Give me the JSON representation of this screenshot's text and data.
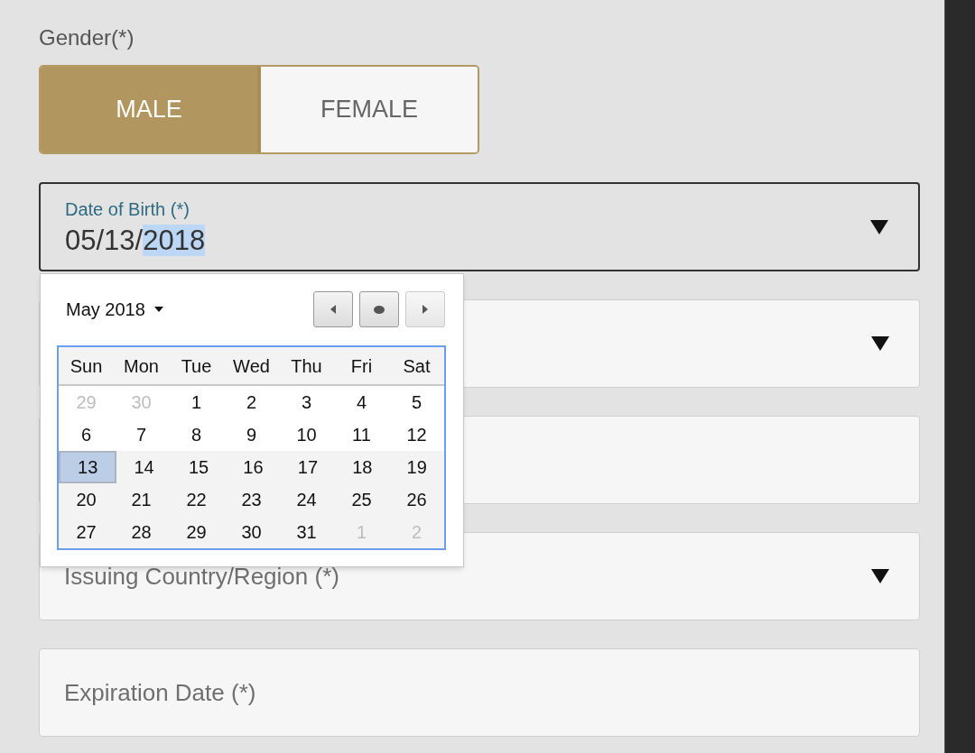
{
  "gender": {
    "label": "Gender(*)",
    "options": [
      {
        "label": "MALE",
        "selected": true
      },
      {
        "label": "FEMALE",
        "selected": false
      }
    ]
  },
  "date_of_birth": {
    "label": "Date of Birth (*)",
    "value_parts": [
      {
        "text": "05/13/",
        "selected": false
      },
      {
        "text": "2018",
        "selected": true
      }
    ],
    "calendar": {
      "month_label": "May 2018",
      "weekdays": [
        "Sun",
        "Mon",
        "Tue",
        "Wed",
        "Thu",
        "Fri",
        "Sat"
      ],
      "weeks": [
        {
          "shaded": false,
          "days": [
            {
              "text": "29",
              "outside": true,
              "selected": false
            },
            {
              "text": "30",
              "outside": true,
              "selected": false
            },
            {
              "text": "1",
              "outside": false,
              "selected": false
            },
            {
              "text": "2",
              "outside": false,
              "selected": false
            },
            {
              "text": "3",
              "outside": false,
              "selected": false
            },
            {
              "text": "4",
              "outside": false,
              "selected": false
            },
            {
              "text": "5",
              "outside": false,
              "selected": false
            }
          ]
        },
        {
          "shaded": false,
          "days": [
            {
              "text": "6",
              "outside": false,
              "selected": false
            },
            {
              "text": "7",
              "outside": false,
              "selected": false
            },
            {
              "text": "8",
              "outside": false,
              "selected": false
            },
            {
              "text": "9",
              "outside": false,
              "selected": false
            },
            {
              "text": "10",
              "outside": false,
              "selected": false
            },
            {
              "text": "11",
              "outside": false,
              "selected": false
            },
            {
              "text": "12",
              "outside": false,
              "selected": false
            }
          ]
        },
        {
          "shaded": true,
          "days": [
            {
              "text": "13",
              "outside": false,
              "selected": true
            },
            {
              "text": "14",
              "outside": false,
              "selected": false
            },
            {
              "text": "15",
              "outside": false,
              "selected": false
            },
            {
              "text": "16",
              "outside": false,
              "selected": false
            },
            {
              "text": "17",
              "outside": false,
              "selected": false
            },
            {
              "text": "18",
              "outside": false,
              "selected": false
            },
            {
              "text": "19",
              "outside": false,
              "selected": false
            }
          ]
        },
        {
          "shaded": true,
          "days": [
            {
              "text": "20",
              "outside": false,
              "selected": false
            },
            {
              "text": "21",
              "outside": false,
              "selected": false
            },
            {
              "text": "22",
              "outside": false,
              "selected": false
            },
            {
              "text": "23",
              "outside": false,
              "selected": false
            },
            {
              "text": "24",
              "outside": false,
              "selected": false
            },
            {
              "text": "25",
              "outside": false,
              "selected": false
            },
            {
              "text": "26",
              "outside": false,
              "selected": false
            }
          ]
        },
        {
          "shaded": true,
          "days": [
            {
              "text": "27",
              "outside": false,
              "selected": false
            },
            {
              "text": "28",
              "outside": false,
              "selected": false
            },
            {
              "text": "29",
              "outside": false,
              "selected": false
            },
            {
              "text": "30",
              "outside": false,
              "selected": false
            },
            {
              "text": "31",
              "outside": false,
              "selected": false
            },
            {
              "text": "1",
              "outside": true,
              "selected": false
            },
            {
              "text": "2",
              "outside": true,
              "selected": false
            }
          ]
        }
      ]
    }
  },
  "fields": [
    {
      "kind": "select"
    },
    {
      "kind": "text"
    },
    {
      "kind": "select",
      "label": "Issuing Country/Region (*)"
    },
    {
      "kind": "text",
      "label": "Expiration Date (*)"
    }
  ]
}
